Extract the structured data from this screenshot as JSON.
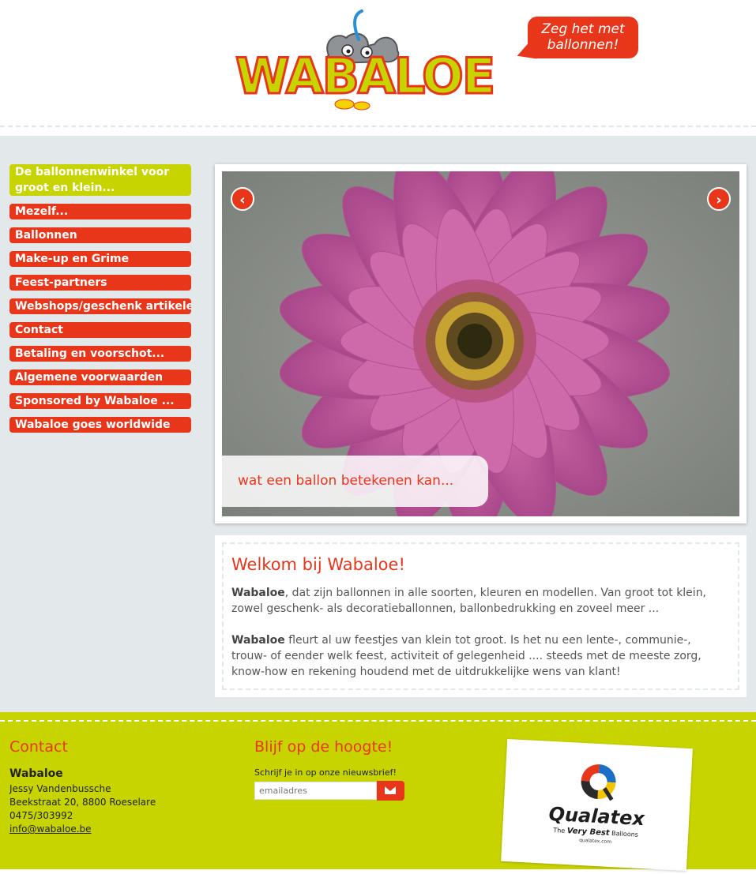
{
  "header": {
    "logo_text": "WABALOE",
    "tagline": "Zeg het met ballonnen!"
  },
  "nav": {
    "items": [
      {
        "label": "De ballonnenwinkel voor groot en klein..."
      },
      {
        "label": "Mezelf..."
      },
      {
        "label": "Ballonnen"
      },
      {
        "label": "Make-up en Grime"
      },
      {
        "label": "Feest-partners"
      },
      {
        "label": "Webshops/geschenk artikelen"
      },
      {
        "label": "Contact"
      },
      {
        "label": "Betaling en voorschot..."
      },
      {
        "label": "Algemene voorwaarden"
      },
      {
        "label": "Sponsored by Wabaloe ..."
      },
      {
        "label": "Wabaloe goes worldwide"
      }
    ]
  },
  "slider": {
    "caption": "wat een ballon betekenen kan...",
    "prev_icon": "chevron-left-icon",
    "next_icon": "chevron-right-icon"
  },
  "welcome": {
    "title": "Welkom bij Wabaloe!",
    "p1_bold": "Wabaloe",
    "p1_text": ", dat zijn ballonnen in alle soorten, kleuren en modellen. Van groot tot klein, zowel geschenk- als decoratieballonnen, ballonbedrukking en zoveel meer ...",
    "p2_bold": "Wabaloe",
    "p2_text": " fleurt al uw feestjes van klein tot groot. Is het nu een lente-, communie-, trouw- of eender welk feest, activiteit of gelegenheid .... steeds met de meeste zorg, know-how en rekening houdend met de uitdrukkelijke wens van klant!"
  },
  "footer": {
    "contact": {
      "title": "Contact",
      "name": "Wabaloe",
      "person": "Jessy Vandenbussche",
      "address": "Beekstraat 20, 8800 Roeselare",
      "phone": "0475/303992",
      "email": "info@wabaloe.be"
    },
    "newsletter": {
      "title": "Blijf op de hoogte!",
      "label": "Schrijf je in op onze nieuwsbrief!",
      "placeholder": "emailadres",
      "button_icon": "envelope-icon"
    },
    "sponsor": {
      "brand": "Qualatex",
      "slogan_pre": "The",
      "slogan_bold": "Very Best",
      "slogan_post": "Balloons",
      "url": "qualatex.com"
    }
  },
  "colors": {
    "brand_red": "#e8361b",
    "brand_lime": "#c8d400",
    "main_bg": "#e3e8eb"
  }
}
